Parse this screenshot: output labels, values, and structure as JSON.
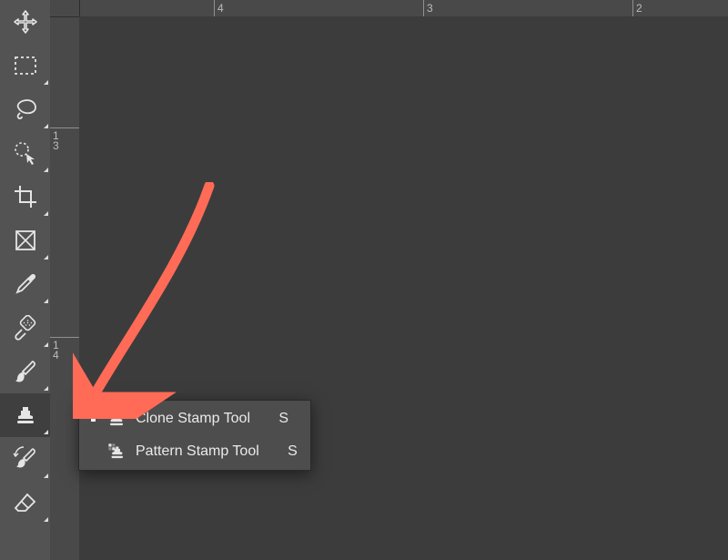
{
  "tools": [
    {
      "id": "move-tool"
    },
    {
      "id": "rectangular-marquee-tool"
    },
    {
      "id": "lasso-tool"
    },
    {
      "id": "quick-selection-tool"
    },
    {
      "id": "crop-tool"
    },
    {
      "id": "frame-tool"
    },
    {
      "id": "eyedropper-tool"
    },
    {
      "id": "spot-healing-brush-tool"
    },
    {
      "id": "brush-tool"
    },
    {
      "id": "clone-stamp-tool",
      "selected": true
    },
    {
      "id": "history-brush-tool"
    },
    {
      "id": "eraser-tool"
    }
  ],
  "ruler": {
    "top_labels": [
      "4",
      "3",
      "2"
    ],
    "left_labels": [
      "13",
      "14"
    ]
  },
  "flyout": {
    "items": [
      {
        "active": true,
        "label": "Clone Stamp Tool",
        "shortcut": "S",
        "icon": "clone-stamp-icon"
      },
      {
        "active": false,
        "label": "Pattern Stamp Tool",
        "shortcut": "S",
        "icon": "pattern-stamp-icon"
      }
    ]
  },
  "colors": {
    "panel": "#535353",
    "flyout": "#4d4d4d",
    "canvas": "#3c3c3c",
    "arrow": "#ff6b57"
  }
}
